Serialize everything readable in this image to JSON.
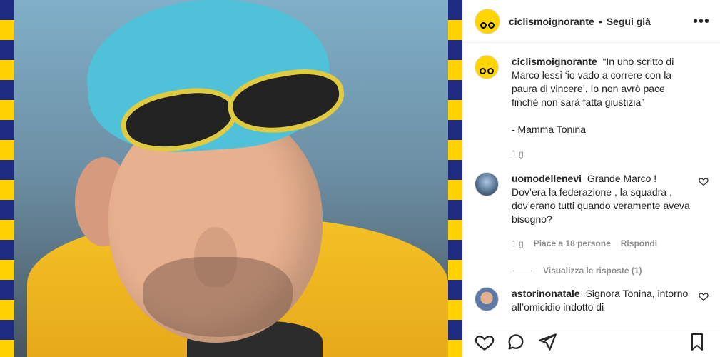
{
  "post": {
    "username": "ciclismoignorante",
    "follow_separator": "•",
    "follow_label": "Segui già",
    "more_label": "•••"
  },
  "comments": [
    {
      "username": "ciclismoignorante",
      "text": "“In uno scritto di Marco lessi ‘io vado a correre con la paura di vincere’. Io non avrò pace finché non sarà fatta giustizia”\n\n- Mamma Tonina",
      "time": "1 g",
      "avatar": "cyclist-logo"
    },
    {
      "username": "uomodellenevi",
      "text": "Grande Marco ! Dov’era la federazione , la squadra , dov’erano tutti quando veramente aveva bisogno?",
      "time": "1 g",
      "likes": "Piace a 18 persone",
      "reply": "Rispondi",
      "view_replies": "Visualizza le risposte (1)",
      "avatar": "snow-mountain"
    },
    {
      "username": "astorinonatale",
      "text": "Signora Tonina, intorno all’omicidio indotto di",
      "avatar": "person-portrait"
    }
  ],
  "icons": {
    "heart": "heart-icon",
    "comment": "comment-icon",
    "share": "share-icon",
    "save": "save-icon"
  }
}
